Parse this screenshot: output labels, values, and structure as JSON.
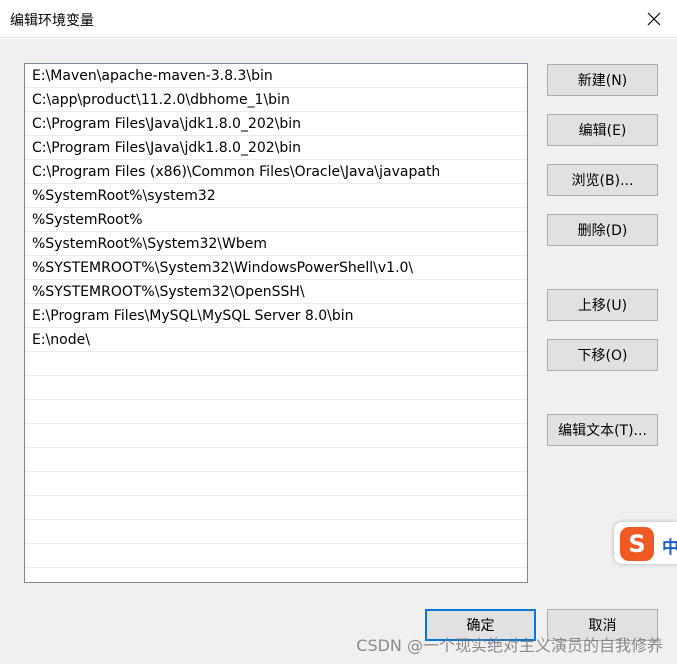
{
  "window": {
    "title": "编辑环境变量",
    "close_icon": "close-icon"
  },
  "path_list": {
    "items": [
      "E:\\Maven\\apache-maven-3.8.3\\bin",
      "C:\\app\\product\\11.2.0\\dbhome_1\\bin",
      "C:\\Program Files\\Java\\jdk1.8.0_202\\bin",
      "C:\\Program Files\\Java\\jdk1.8.0_202\\bin",
      "C:\\Program Files (x86)\\Common Files\\Oracle\\Java\\javapath",
      "%SystemRoot%\\system32",
      "%SystemRoot%",
      "%SystemRoot%\\System32\\Wbem",
      "%SYSTEMROOT%\\System32\\WindowsPowerShell\\v1.0\\",
      "%SYSTEMROOT%\\System32\\OpenSSH\\",
      "E:\\Program Files\\MySQL\\MySQL Server 8.0\\bin",
      "E:\\node\\",
      "",
      "",
      "",
      "",
      "",
      "",
      "",
      "",
      "",
      ""
    ]
  },
  "buttons": {
    "new": "新建(N)",
    "edit": "编辑(E)",
    "browse": "浏览(B)...",
    "delete": "删除(D)",
    "move_up": "上移(U)",
    "move_down": "下移(O)",
    "edit_text": "编辑文本(T)...",
    "ok": "确定",
    "cancel": "取消"
  },
  "ime": {
    "logo_letter": "S",
    "mode": "中"
  },
  "watermark": "CSDN @一个现实绝对主义演员的自我修养",
  "colors": {
    "focus_border": "#0078d7",
    "dialog_bg": "#f0f0f0",
    "ime_orange": "#f05a22"
  }
}
